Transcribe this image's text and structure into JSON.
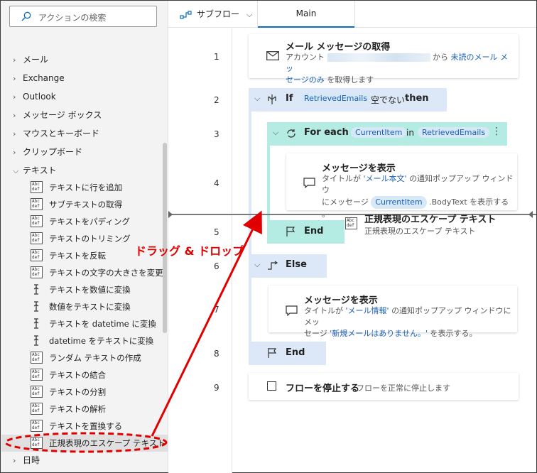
{
  "search": {
    "placeholder": "アクションの検索"
  },
  "categories": [
    {
      "label": "メール",
      "expanded": false
    },
    {
      "label": "Exchange",
      "expanded": false
    },
    {
      "label": "Outlook",
      "expanded": false
    },
    {
      "label": "メッセージ ボックス",
      "expanded": false
    },
    {
      "label": "マウスとキーボード",
      "expanded": false
    },
    {
      "label": "クリップボード",
      "expanded": false
    },
    {
      "label": "テキスト",
      "expanded": true
    }
  ],
  "text_actions": [
    {
      "label": "テキストに行を追加",
      "icon": "abc-def-icon"
    },
    {
      "label": "サブテキストの取得",
      "icon": "abc-def-icon"
    },
    {
      "label": "テキストをパディング",
      "icon": "abc-def-icon"
    },
    {
      "label": "テキストのトリミング",
      "icon": "abc-def-icon"
    },
    {
      "label": "テキストを反転",
      "icon": "abc-def-icon"
    },
    {
      "label": "テキストの文字の大きさを変更",
      "icon": "abc-def-icon"
    },
    {
      "label": "テキストを数値に変換",
      "icon": "convert-icon"
    },
    {
      "label": "数値をテキストに変換",
      "icon": "convert-icon"
    },
    {
      "label": "テキストを datetime に変換",
      "icon": "convert-icon"
    },
    {
      "label": "datetime をテキストに変換",
      "icon": "convert-icon"
    },
    {
      "label": "ランダム テキストの作成",
      "icon": "abc-def-icon"
    },
    {
      "label": "テキストの結合",
      "icon": "abc-def-icon"
    },
    {
      "label": "テキストの分割",
      "icon": "abc-def-icon"
    },
    {
      "label": "テキストの解析",
      "icon": "abc-def-icon"
    },
    {
      "label": "テキストを置換する",
      "icon": "abc-def-icon"
    },
    {
      "label": "正規表現のエスケープ テキスト",
      "icon": "abc-def-icon",
      "selected": true
    }
  ],
  "last_category": {
    "label": "日時"
  },
  "topbar": {
    "subflow_label": "サブフロー",
    "tab_main": "Main"
  },
  "line_numbers": [
    "1",
    "2",
    "3",
    "4",
    "5",
    "6",
    "7",
    "8",
    "9"
  ],
  "flow": {
    "step1": {
      "title": "メール メッセージの取得",
      "desc_prefix": "アカウント",
      "desc_mid": "から",
      "desc_link1": "未読のメール メッ",
      "desc_link2": "セージのみ",
      "desc_suffix": "を取得します"
    },
    "if_block": {
      "keyword": "If",
      "var": "RetrievedEmails",
      "condition": "空でない",
      "then": "then"
    },
    "foreach": {
      "keyword": "For each",
      "item": "CurrentItem",
      "in": "in",
      "collection": "RetrievedEmails"
    },
    "step4": {
      "title": "メッセージを表示",
      "line1_prefix": "タイトルが",
      "line1_value": "'メール本文'",
      "line1_suffix": "の通知ポップアップ ウィンドウ",
      "line2_prefix": "にメッセージ",
      "line2_token": "CurrentItem",
      "line2_suffix": ".BodyText を表示する",
      "line3": "。"
    },
    "end_foreach": "End",
    "else_block": "Else",
    "step7": {
      "title": "メッセージを表示",
      "line1_prefix": "タイトルが",
      "line1_value": "'メール情報'",
      "line1_suffix": "の通知ポップアップ ウィンドウにメッ",
      "line2_prefix": "セージ",
      "line2_value": "'新規メールはありません。'",
      "line2_suffix": "を表示する。"
    },
    "end_if": "End",
    "step9": {
      "title": "フローを停止する",
      "desc": "フローを正常に停止します"
    }
  },
  "drag_preview": {
    "title": "正規表現のエスケープ テキスト",
    "subtitle": "正規表現のエスケープ テキスト"
  },
  "annotation": {
    "label": "ドラッグ & ドロップ",
    "color": "#e00000"
  },
  "colors": {
    "if_block": "#dce8f8",
    "foreach_block": "#b4ece4",
    "accent": "#0f6cbd"
  }
}
